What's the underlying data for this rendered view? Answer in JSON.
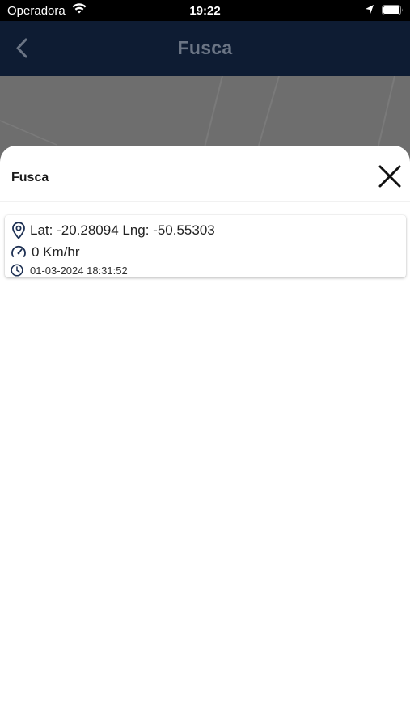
{
  "status_bar": {
    "carrier": "Operadora",
    "time": "19:22",
    "icons": [
      "wifi-icon",
      "location-arrow-icon",
      "battery-icon"
    ]
  },
  "nav": {
    "title": "Fusca",
    "back_icon": "chevron-left-icon"
  },
  "sheet": {
    "title": "Fusca",
    "close_icon": "close-icon"
  },
  "vehicle": {
    "coordinates": "Lat: -20.28094 Lng: -50.55303",
    "speed": "0 Km/hr",
    "timestamp": "01-03-2024 18:31:52"
  },
  "colors": {
    "nav_background": "#0e1c33",
    "icon_accent": "#1c2f52"
  }
}
